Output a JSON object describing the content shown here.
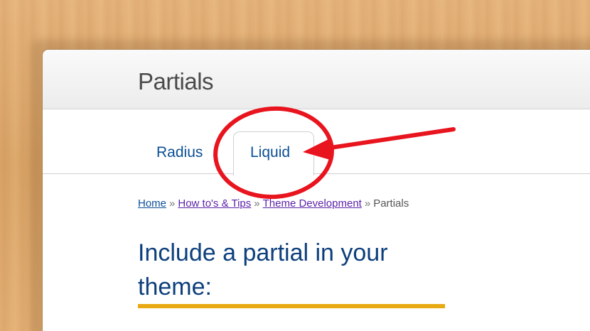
{
  "page": {
    "title": "Partials"
  },
  "tabs": [
    {
      "label": "Radius",
      "active": false
    },
    {
      "label": "Liquid",
      "active": true
    }
  ],
  "breadcrumb": {
    "items": [
      {
        "label": "Home"
      },
      {
        "label": "How to's & Tips"
      },
      {
        "label": "Theme Development"
      },
      {
        "label": "Partials"
      }
    ],
    "separator": "»"
  },
  "content": {
    "heading": "Include a partial in your theme:"
  },
  "colors": {
    "link": "#0b4f95",
    "visited_link": "#5b1fa8",
    "heading": "#0d3f7c",
    "underline_accent": "#e9a913",
    "annotation": "#e8141e"
  },
  "annotation": {
    "shape": "circle-and-arrow",
    "target": "Liquid tab"
  }
}
